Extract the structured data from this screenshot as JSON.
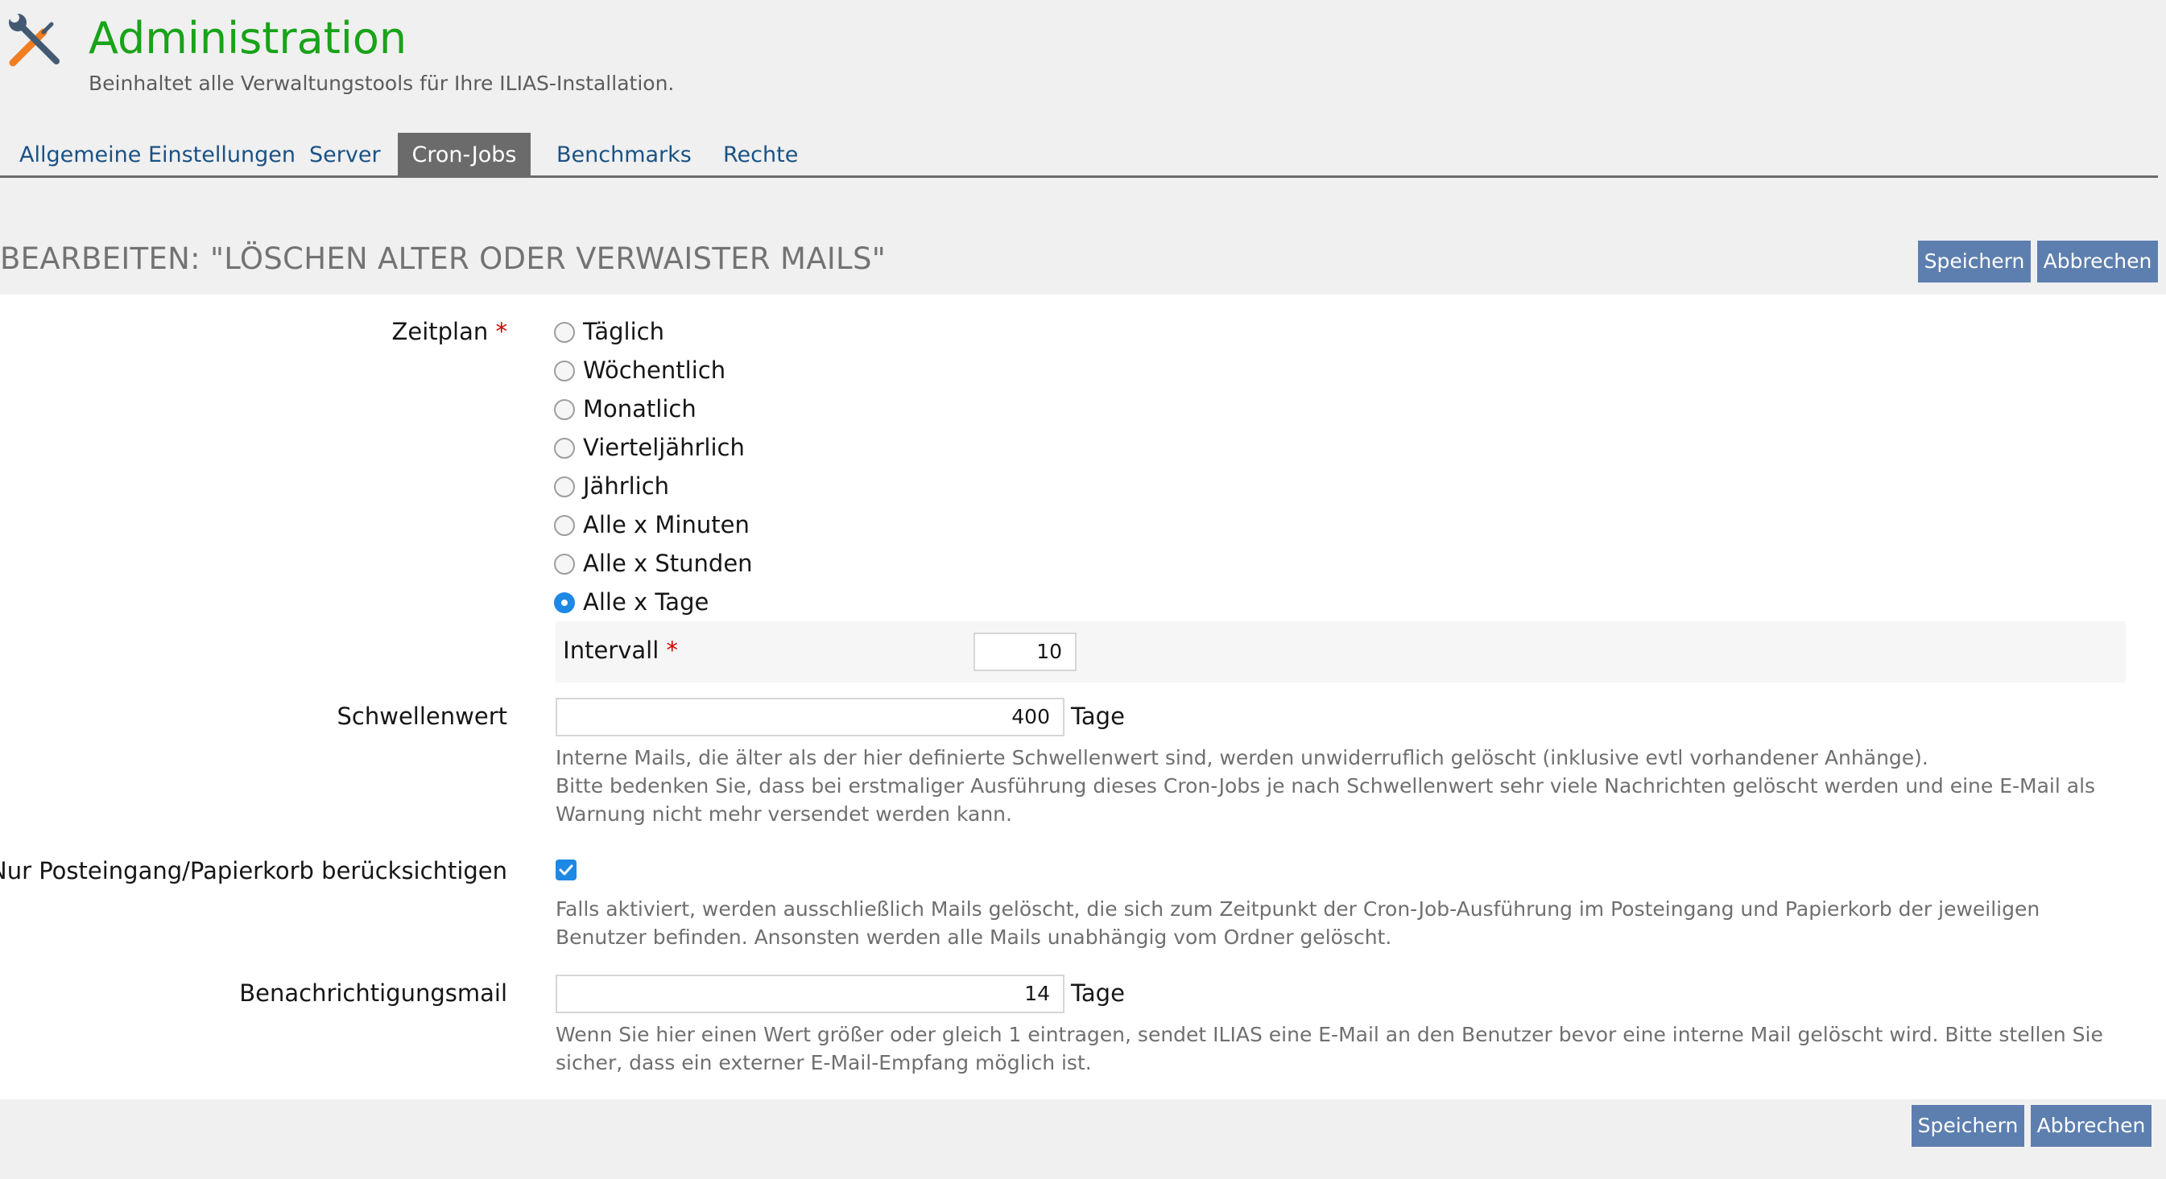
{
  "header": {
    "title": "Administration",
    "description": "Beinhaltet alle Verwaltungstools für Ihre ILIAS-Installation.",
    "icon": "tools-icon"
  },
  "tabs": [
    {
      "label": "Allgemeine Einstellungen",
      "active": false
    },
    {
      "label": "Server",
      "active": false
    },
    {
      "label": "Cron-Jobs",
      "active": true
    },
    {
      "label": "Benchmarks",
      "active": false
    },
    {
      "label": "Rechte",
      "active": false
    }
  ],
  "form": {
    "title": "BEARBEITEN: \"LÖSCHEN ALTER ODER VERWAISTER MAILS\"",
    "save_label": "Speichern",
    "cancel_label": "Abbrechen",
    "required_mark": "*",
    "schedule": {
      "label": "Zeitplan",
      "options": [
        {
          "label": "Täglich",
          "checked": false
        },
        {
          "label": "Wöchentlich",
          "checked": false
        },
        {
          "label": "Monatlich",
          "checked": false
        },
        {
          "label": "Vierteljährlich",
          "checked": false
        },
        {
          "label": "Jährlich",
          "checked": false
        },
        {
          "label": "Alle x Minuten",
          "checked": false
        },
        {
          "label": "Alle x Stunden",
          "checked": false
        },
        {
          "label": "Alle x Tage",
          "checked": true
        }
      ],
      "interval_label": "Intervall",
      "interval_value": "10"
    },
    "threshold": {
      "label": "Schwellenwert",
      "value": "400",
      "unit": "Tage",
      "help_1": "Interne Mails, die älter als der hier definierte Schwellenwert sind, werden unwiderruflich gelöscht (inklusive evtl vorhandener Anhänge).",
      "help_2": "Bitte bedenken Sie, dass bei erstmaliger Ausführung dieses Cron-Jobs je nach Schwellenwert sehr viele Nachrichten gelöscht werden und eine E-Mail als Warnung nicht mehr versendet werden kann."
    },
    "inbox_only": {
      "label": "Nur Posteingang/Papierkorb berücksichtigen",
      "checked": true,
      "help": "Falls aktiviert, werden ausschließlich Mails gelöscht, die sich zum Zeitpunkt der Cron-Job-Ausführung im Posteingang und Papierkorb der jeweiligen Benutzer befinden. Ansonsten werden alle Mails unabhängig vom Ordner gelöscht."
    },
    "notification": {
      "label": "Benachrichtigungsmail",
      "value": "14",
      "unit": "Tage",
      "help": "Wenn Sie hier einen Wert größer oder gleich 1 eintragen, sendet ILIAS eine E-Mail an den Benutzer bevor eine interne Mail gelöscht wird. Bitte stellen Sie sicher, dass ein externer E-Mail-Empfang möglich ist."
    }
  },
  "colors": {
    "title": "#18a318",
    "tab_link": "#1a5285",
    "tab_active_bg": "#6b6b6b",
    "button": "#5d7faf",
    "accent": "#1e88e5",
    "required": "#d00000"
  }
}
